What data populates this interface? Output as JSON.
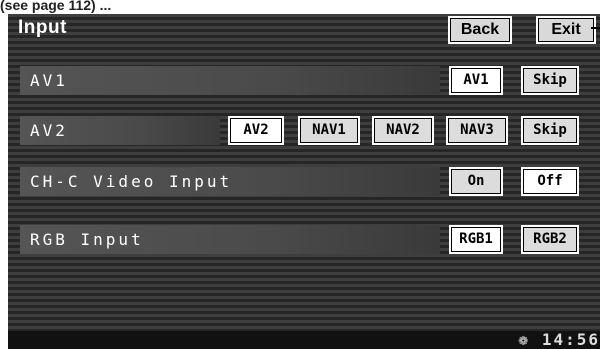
{
  "caption": "(see page 112) ...",
  "header": {
    "title": "Input",
    "back_label": "Back",
    "exit_label": "Exit"
  },
  "rows": [
    {
      "label": "AV1",
      "buttons": [
        {
          "label": "AV1",
          "state": "selected"
        },
        {
          "label": "Skip",
          "state": "unselected"
        }
      ]
    },
    {
      "label": "AV2",
      "buttons": [
        {
          "label": "AV2",
          "state": "selected"
        },
        {
          "label": "NAV1",
          "state": "unselected"
        },
        {
          "label": "NAV2",
          "state": "unselected"
        },
        {
          "label": "NAV3",
          "state": "unselected"
        },
        {
          "label": "Skip",
          "state": "unselected"
        }
      ]
    },
    {
      "label": "CH-C Video Input",
      "buttons": [
        {
          "label": "On",
          "state": "unselected"
        },
        {
          "label": "Off",
          "state": "selected"
        }
      ]
    },
    {
      "label": "RGB Input",
      "buttons": [
        {
          "label": "RGB1",
          "state": "selected"
        },
        {
          "label": "RGB2",
          "state": "unselected"
        }
      ]
    }
  ],
  "status": {
    "clock": "14:56",
    "icon": "gps-icon"
  }
}
